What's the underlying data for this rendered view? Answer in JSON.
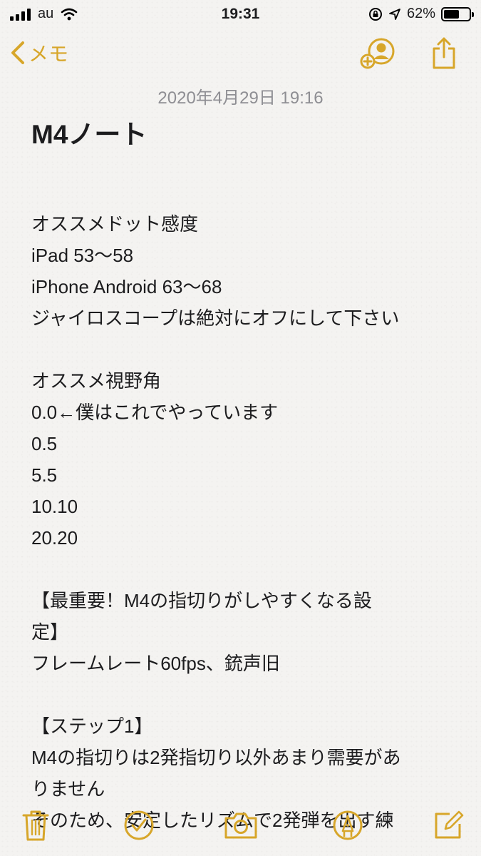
{
  "status": {
    "carrier": "au",
    "time": "19:31",
    "battery": "62%",
    "battery_level": 0.62
  },
  "nav": {
    "back_label": "メモ"
  },
  "note": {
    "date": "2020年4月29日 19:16",
    "title": "M4ノート",
    "lines": [
      "",
      "オススメドット感度",
      "iPad 53〜58",
      "iPhone Android 63〜68",
      "ジャイロスコープは絶対にオフにして下さい",
      "",
      "オススメ視野角",
      "0.0←僕はこれでやっています",
      "0.5",
      "5.5",
      "10.10",
      "20.20",
      "",
      "【最重要！M4の指切りがしやすくなる設",
      "定】",
      "フレームレート60fps、銃声旧",
      "",
      "【ステップ1】",
      "M4の指切りは2発指切り以外あまり需要があ",
      "りません",
      "そのため、安定したリズムで2発弾を出す練"
    ]
  },
  "colors": {
    "accent": "#d7a62a",
    "background": "#f4f3f1",
    "date_text": "#8e8e93"
  },
  "icons": {
    "nav": [
      "chevron-left-icon",
      "add-person-icon",
      "share-icon"
    ],
    "toolbar": [
      "trash-icon",
      "checkmark-circle-icon",
      "camera-icon",
      "markup-pen-icon",
      "compose-icon"
    ]
  }
}
